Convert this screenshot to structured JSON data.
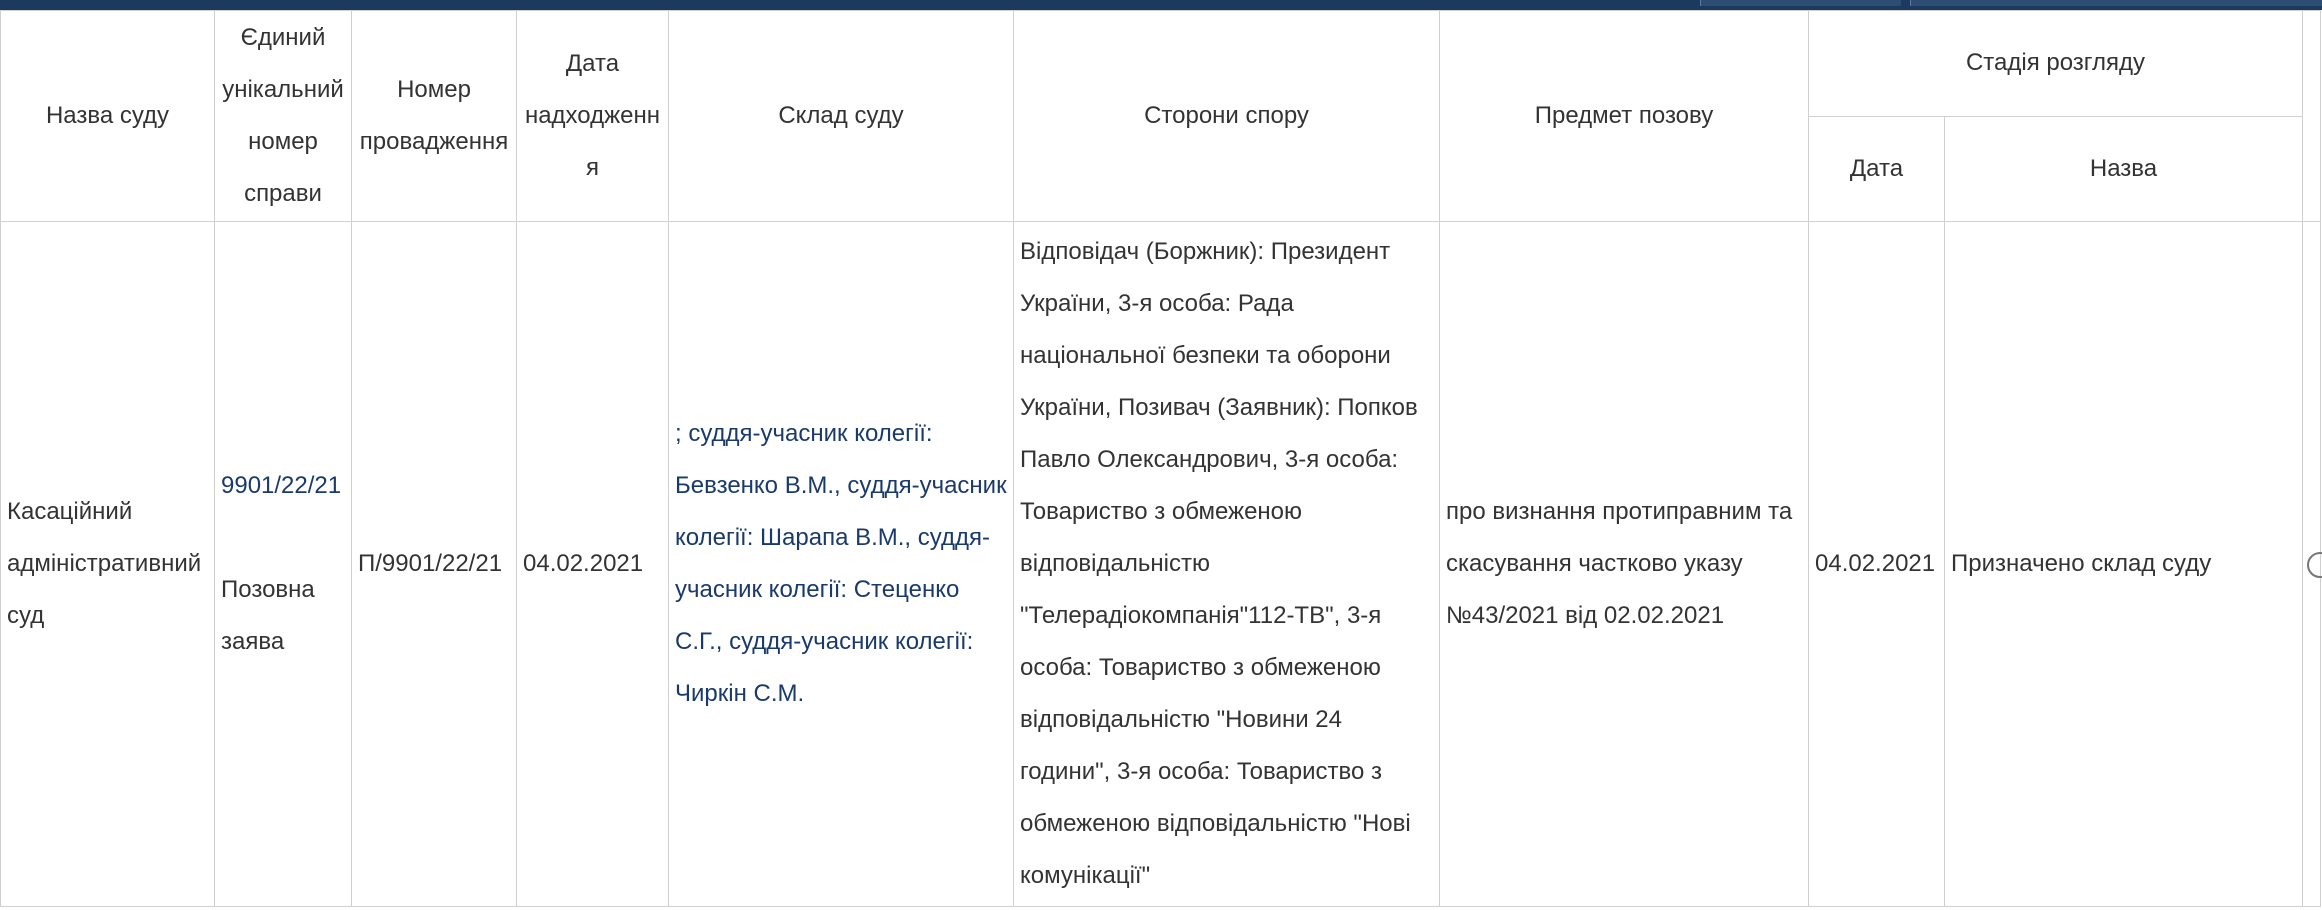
{
  "columns": {
    "court_name": "Назва суду",
    "case_number": [
      "Єдиний",
      "унікальний",
      "номер",
      "справи"
    ],
    "proceeding_number": [
      "Номер",
      "провадження"
    ],
    "received_date": [
      "Дата",
      "надходження"
    ],
    "court_panel": "Склад суду",
    "parties": "Сторони спору",
    "subject": "Предмет позову",
    "stage_group": "Стадія розгляду",
    "stage_date": "Дата",
    "stage_name": "Назва"
  },
  "row": {
    "court_name": "Касаційний адміністративний суд",
    "case_number": "9901/22/21",
    "case_type": "Позовна заява",
    "proceeding_number": "П/9901/22/21",
    "received_date": "04.02.2021",
    "court_panel": "; суддя-учасник колегії: Бевзенко В.М., суддя-учасник колегії: Шарапа В.М., суддя-учасник колегії: Стеценко С.Г., суддя-учасник колегії: Чиркін С.М.",
    "parties": "Відповідач (Боржник): Президент України, 3-я особа: Рада національної безпеки та оборони України, Позивач (Заявник): Попков Павло Олександрович, 3-я особа: Товариство з обмеженою відповідальністю \"Телерадіокомпанія\"112-ТВ\", 3-я особа: Товариство з обмеженою відповідальністю \"Новини 24 години\", 3-я особа: Товариство з обмеженою відповідальністю \"Нові комунікації\"",
    "subject": "про визнання протиправним та скасування частково указу №43/2021 від 02.02.2021",
    "stage_date": "04.02.2021",
    "stage_name": "Призначено склад суду"
  }
}
